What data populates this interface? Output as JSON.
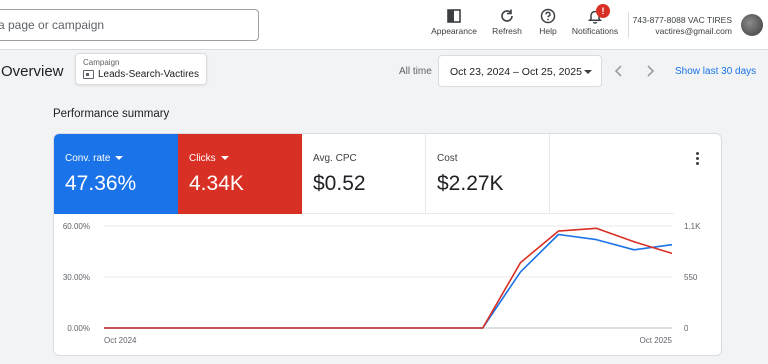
{
  "topbar": {
    "search_placeholder": "a page or campaign",
    "tools": [
      {
        "label": "Appearance",
        "icon": "appearance-icon"
      },
      {
        "label": "Refresh",
        "icon": "refresh-icon"
      },
      {
        "label": "Help",
        "icon": "help-icon"
      },
      {
        "label": "Notifications",
        "icon": "bell-icon",
        "badge": "!"
      }
    ],
    "account_line1": "743-877-8088 VAC TIRES",
    "account_line2": "vactires@gmail.com"
  },
  "header": {
    "title": "Overview",
    "campaign_caption": "Campaign",
    "campaign_name": "Leads-Search-Vactires",
    "all_time": "All time",
    "date_range": "Oct 23, 2024 – Oct 25, 2025",
    "show_last": "Show last 30 days"
  },
  "summary": {
    "title": "Performance summary",
    "metrics": [
      {
        "label": "Conv. rate",
        "value": "47.36%",
        "color": "#1a73e8"
      },
      {
        "label": "Clicks",
        "value": "4.34K",
        "color": "#d93025"
      },
      {
        "label": "Avg. CPC",
        "value": "$0.52"
      },
      {
        "label": "Cost",
        "value": "$2.27K"
      }
    ]
  },
  "chart_data": {
    "type": "line",
    "x_labels": [
      "Oct 2024",
      "Oct 2025"
    ],
    "left_axis": {
      "ticks": [
        "0.00%",
        "30.00%",
        "60.00%"
      ],
      "range": [
        0,
        60
      ]
    },
    "right_axis": {
      "ticks": [
        "0",
        "550",
        "1.1K"
      ],
      "range": [
        0,
        1100
      ]
    },
    "grid": true,
    "series": [
      {
        "name": "Conv. rate",
        "axis": "left",
        "color": "#1a73e8",
        "values": [
          0,
          0,
          0,
          0,
          0,
          0,
          0,
          0,
          0,
          0,
          0,
          33,
          55,
          52,
          46,
          49
        ]
      },
      {
        "name": "Clicks",
        "axis": "right",
        "color": "#d93025",
        "values": [
          0,
          0,
          0,
          0,
          0,
          0,
          0,
          0,
          0,
          0,
          0,
          705,
          1045,
          1075,
          930,
          805
        ]
      }
    ]
  }
}
